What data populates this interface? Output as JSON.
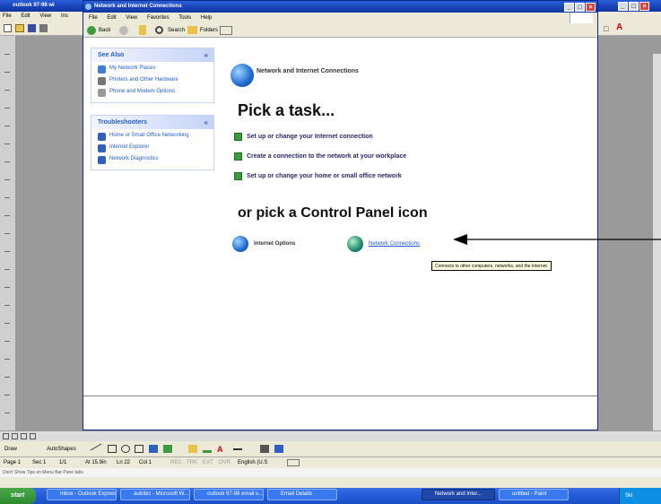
{
  "window": {
    "title": "Network and Internet Connections",
    "left_title": "outlook 97-98 wi",
    "menu": [
      "File",
      "Edit",
      "View",
      "Favorites",
      "Tools",
      "Help"
    ],
    "left_menu": [
      "File",
      "Edit",
      "View",
      "Ins"
    ],
    "toolbar": {
      "back_label": "Back",
      "search_label": "Search",
      "folders_label": "Folders"
    }
  },
  "sidebar": {
    "see_also": {
      "title": "See Also",
      "items": [
        {
          "label": "My Network Places",
          "icon": "network-places-icon"
        },
        {
          "label": "Printers and Other Hardware",
          "icon": "printer-icon"
        },
        {
          "label": "Phone and Modem Options",
          "icon": "phone-icon"
        }
      ]
    },
    "troubleshooters": {
      "title": "Troubleshooters",
      "items": [
        {
          "label": "Home or Small Office Networking",
          "icon": "help-icon"
        },
        {
          "label": "Internet Explorer",
          "icon": "help-icon"
        },
        {
          "label": "Network Diagnostics",
          "icon": "help-icon"
        }
      ]
    }
  },
  "main": {
    "header": "Network and Internet Connections",
    "pick_task": "Pick a task...",
    "tasks": [
      "Set up or change your Internet connection",
      "Create a connection to the network at your workplace",
      "Set up or change your home or small office network"
    ],
    "pick_icon": "or pick a Control Panel icon",
    "icons": [
      {
        "label": "Internet Options"
      },
      {
        "label": "Network Connections"
      }
    ],
    "tooltip": "Connects to other computers, networks, and the Internet."
  },
  "word": {
    "drawing_label": "Draw",
    "autoshapes_label": "AutoShapes",
    "status": {
      "page": "Page 1",
      "sec": "Sec 1",
      "pages": "1/1",
      "at": "At 15.9in",
      "ln": "Ln 22",
      "col": "Col 1",
      "flags": [
        "REC",
        "TRK",
        "EXT",
        "OVR"
      ],
      "lang": "English (U.S"
    },
    "status_note": "Don't Show Tips on Menu Bar Pane tabs"
  },
  "taskbar": {
    "start": "start",
    "buttons": [
      "Inbox - Outlook Express",
      "autobiz - Microsoft W...",
      "outlook 97-98 email s...",
      "Email Details",
      "Network and Inter...",
      "untitled - Paint"
    ],
    "tray_time": "Ski"
  },
  "colors": {
    "xp_blue": "#1a43b8",
    "link_blue": "#215dc6",
    "task_green": "#3c9b3c"
  }
}
